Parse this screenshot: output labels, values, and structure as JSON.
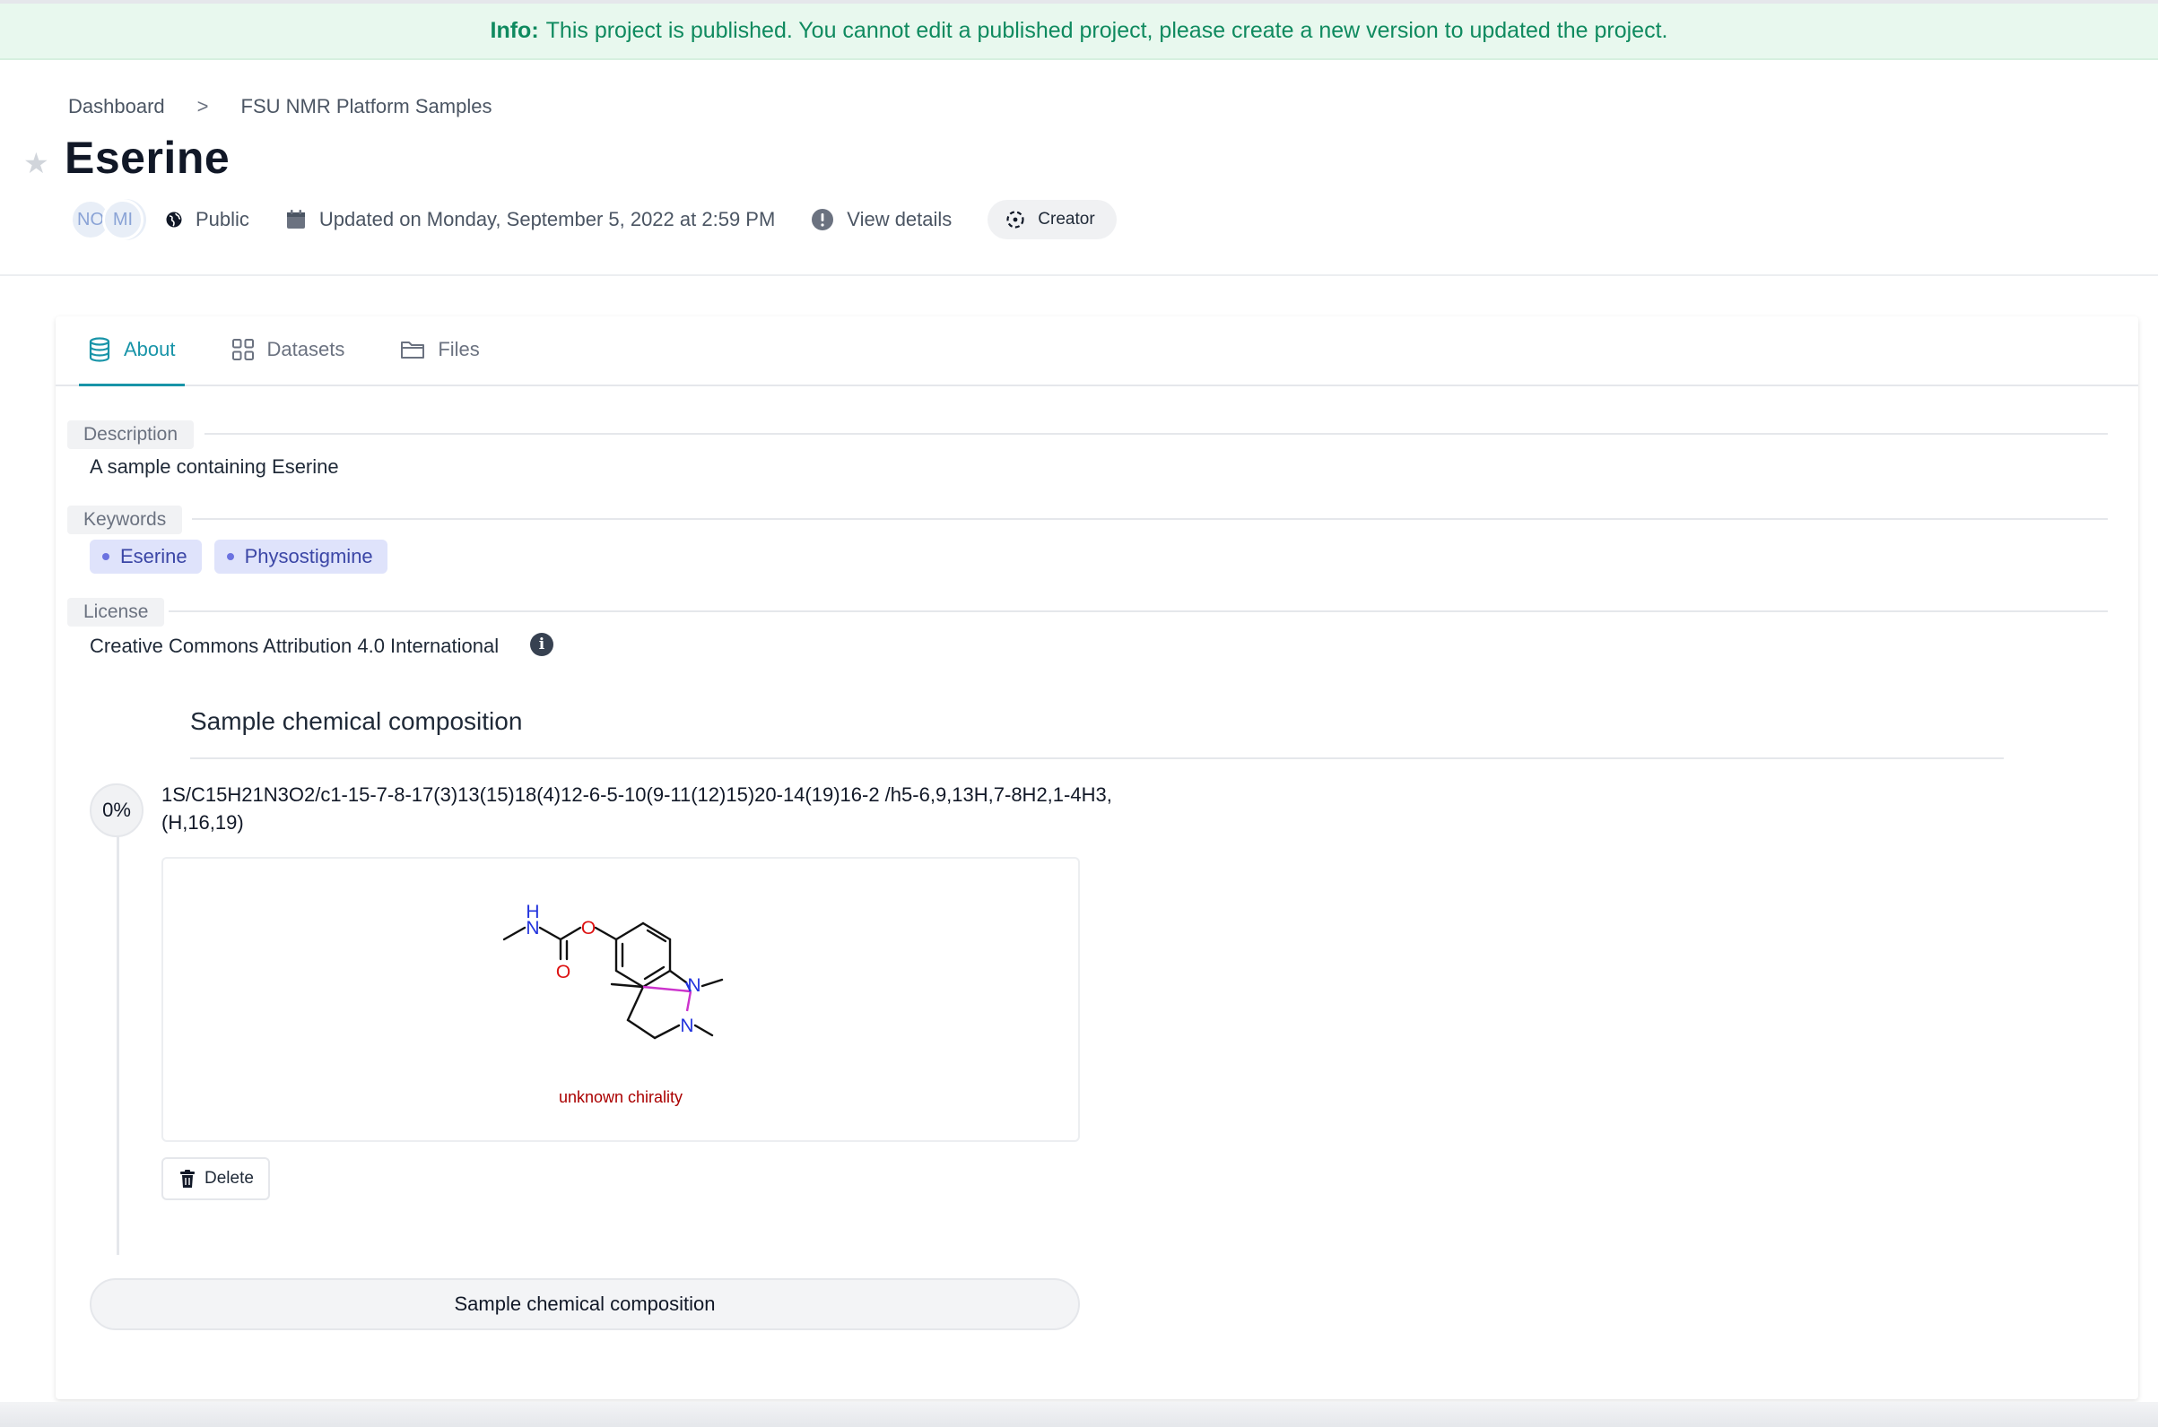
{
  "info_bar": {
    "label": "Info:",
    "message": "This project is published. You cannot edit a published project, please create a new version to updated the project."
  },
  "breadcrumb": {
    "items": [
      "Dashboard",
      "FSU NMR Platform Samples"
    ],
    "separator": ">"
  },
  "project": {
    "title": "Eserine",
    "avatars": [
      "NO",
      "MI"
    ],
    "visibility": "Public",
    "updated": "Updated on Monday, September 5, 2022 at 2:59 PM",
    "view_details": "View details",
    "role": "Creator"
  },
  "tabs": [
    {
      "label": "About",
      "icon": "database-icon",
      "active": true
    },
    {
      "label": "Datasets",
      "icon": "grid-icon",
      "active": false
    },
    {
      "label": "Files",
      "icon": "folder-icon",
      "active": false
    }
  ],
  "about": {
    "description_label": "Description",
    "description": "A sample containing Eserine",
    "keywords_label": "Keywords",
    "keywords": [
      "Eserine",
      "Physostigmine"
    ],
    "license_label": "License",
    "license": "Creative Commons Attribution 4.0 International"
  },
  "composition": {
    "title": "Sample chemical composition",
    "percentage": "0%",
    "inchi": "1S/C15H21N3O2/c1-15-7-8-17(3)13(15)18(4)12-6-5-10(9-11(12)15)20-14(19)16-2 /h5-6,9,13H,7-8H2,1-4H3,(H,16,19)",
    "structure_note": "unknown chirality",
    "atom_labels": {
      "h": "H",
      "n1": "N",
      "o1": "O",
      "o2": "O",
      "n2": "N",
      "n3": "N"
    },
    "delete_label": "Delete",
    "add_button": "Sample chemical composition"
  },
  "colors": {
    "accent": "#1894a8",
    "info_text": "#0f8a5f",
    "info_bg": "#e8f8ee",
    "keyword_bg": "#dfe3fb",
    "stereo_magenta": "#cc33cc",
    "nitrogen": "#2233dd",
    "oxygen": "#dd1111",
    "chirality_note": "#aa0000"
  }
}
